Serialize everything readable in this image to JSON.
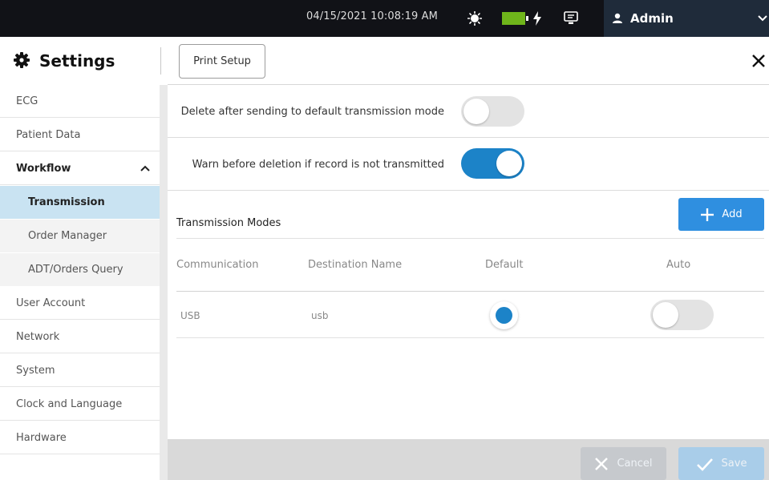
{
  "statusbar": {
    "datetime": "04/15/2021 10:08:19 AM",
    "icons": [
      "sun-icon",
      "battery-icon",
      "bolt-icon",
      "monitor-icon"
    ],
    "user": {
      "name": "Admin",
      "icon": "user-icon",
      "menu_icon": "chevron-down-icon"
    },
    "colors": {
      "background": "#111217",
      "user_box": "#1f2b3a",
      "battery": "#6fb51b"
    }
  },
  "header": {
    "title": "Settings",
    "title_icon": "gear-icon",
    "print_setup_label": "Print Setup",
    "close_icon": "close-icon"
  },
  "sidebar": {
    "items": [
      {
        "label": "ECG"
      },
      {
        "label": "Patient Data"
      },
      {
        "label": "Workflow",
        "expanded": true
      },
      {
        "label": "Transmission",
        "selected": true
      },
      {
        "label": "Order Manager"
      },
      {
        "label": "ADT/Orders Query"
      },
      {
        "label": "User Account"
      },
      {
        "label": "Network"
      },
      {
        "label": "System"
      },
      {
        "label": "Clock and Language"
      },
      {
        "label": "Hardware"
      }
    ]
  },
  "settings": {
    "delete_after_sending": {
      "label": "Delete after sending to default transmission mode",
      "enabled": false
    },
    "warn_before_deletion": {
      "label": "Warn before deletion if record is not transmitted",
      "enabled": true
    }
  },
  "transmission_modes": {
    "title": "Transmission Modes",
    "add_label": "Add",
    "columns": [
      "Communication",
      "Destination Name",
      "Default",
      "Auto"
    ],
    "rows": [
      {
        "communication": "USB",
        "destination": "usb",
        "default": true,
        "auto": false
      }
    ]
  },
  "footer": {
    "cancel_label": "Cancel",
    "save_label": "Save",
    "cancel_enabled": false,
    "save_enabled": false
  },
  "colors": {
    "accent": "#1c83c8",
    "add_button": "#2f8fe0",
    "selected_nav": "#c9e3f2"
  }
}
